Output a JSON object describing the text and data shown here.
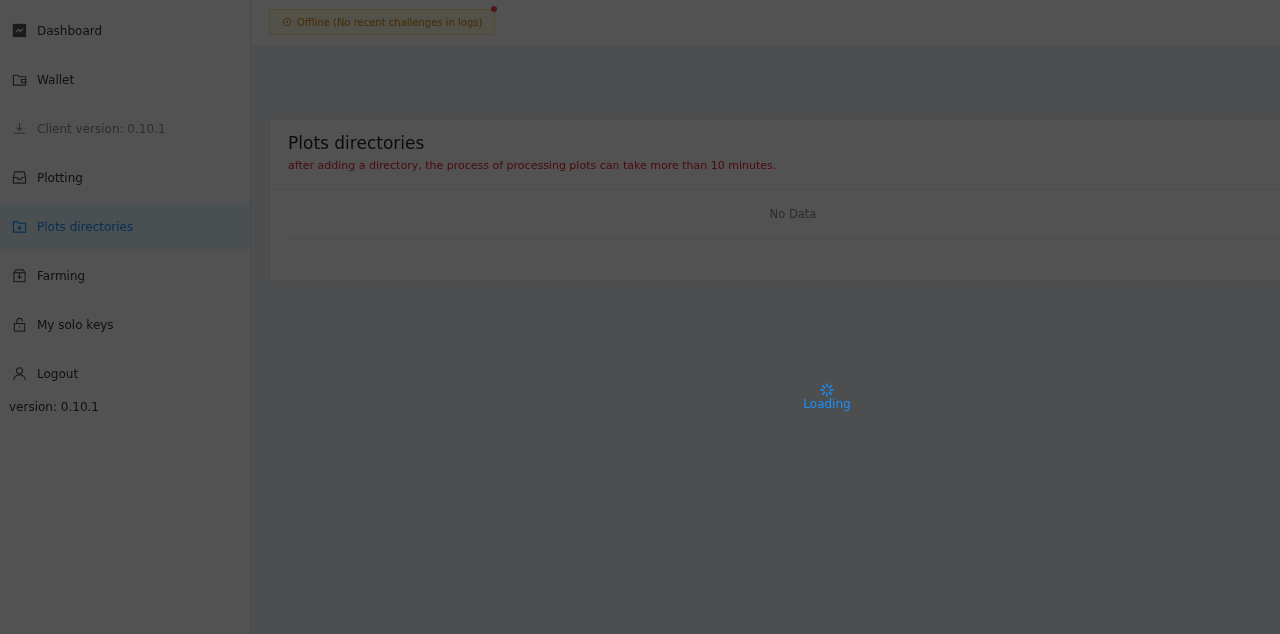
{
  "sidebar": {
    "items": [
      {
        "label": "Dashboard",
        "selected": false,
        "disabled": false
      },
      {
        "label": "Wallet",
        "selected": false,
        "disabled": false
      },
      {
        "label": "Client version: 0.10.1",
        "selected": false,
        "disabled": true
      },
      {
        "label": "Plotting",
        "selected": false,
        "disabled": false
      },
      {
        "label": "Plots directories",
        "selected": true,
        "disabled": false
      },
      {
        "label": "Farming",
        "selected": false,
        "disabled": false
      },
      {
        "label": "My solo keys",
        "selected": false,
        "disabled": false
      },
      {
        "label": "Logout",
        "selected": false,
        "disabled": false
      }
    ],
    "version": "version: 0.10.1"
  },
  "status_badge": {
    "label": "Offline (No recent challenges in logs)",
    "notification_dot": true
  },
  "card": {
    "title": "Plots directories",
    "warning": "after adding a directory, the process of processing plots can take more than 10 minutes.",
    "table": {
      "empty_text": "No Data"
    }
  },
  "loading": {
    "label": "Loading"
  }
}
